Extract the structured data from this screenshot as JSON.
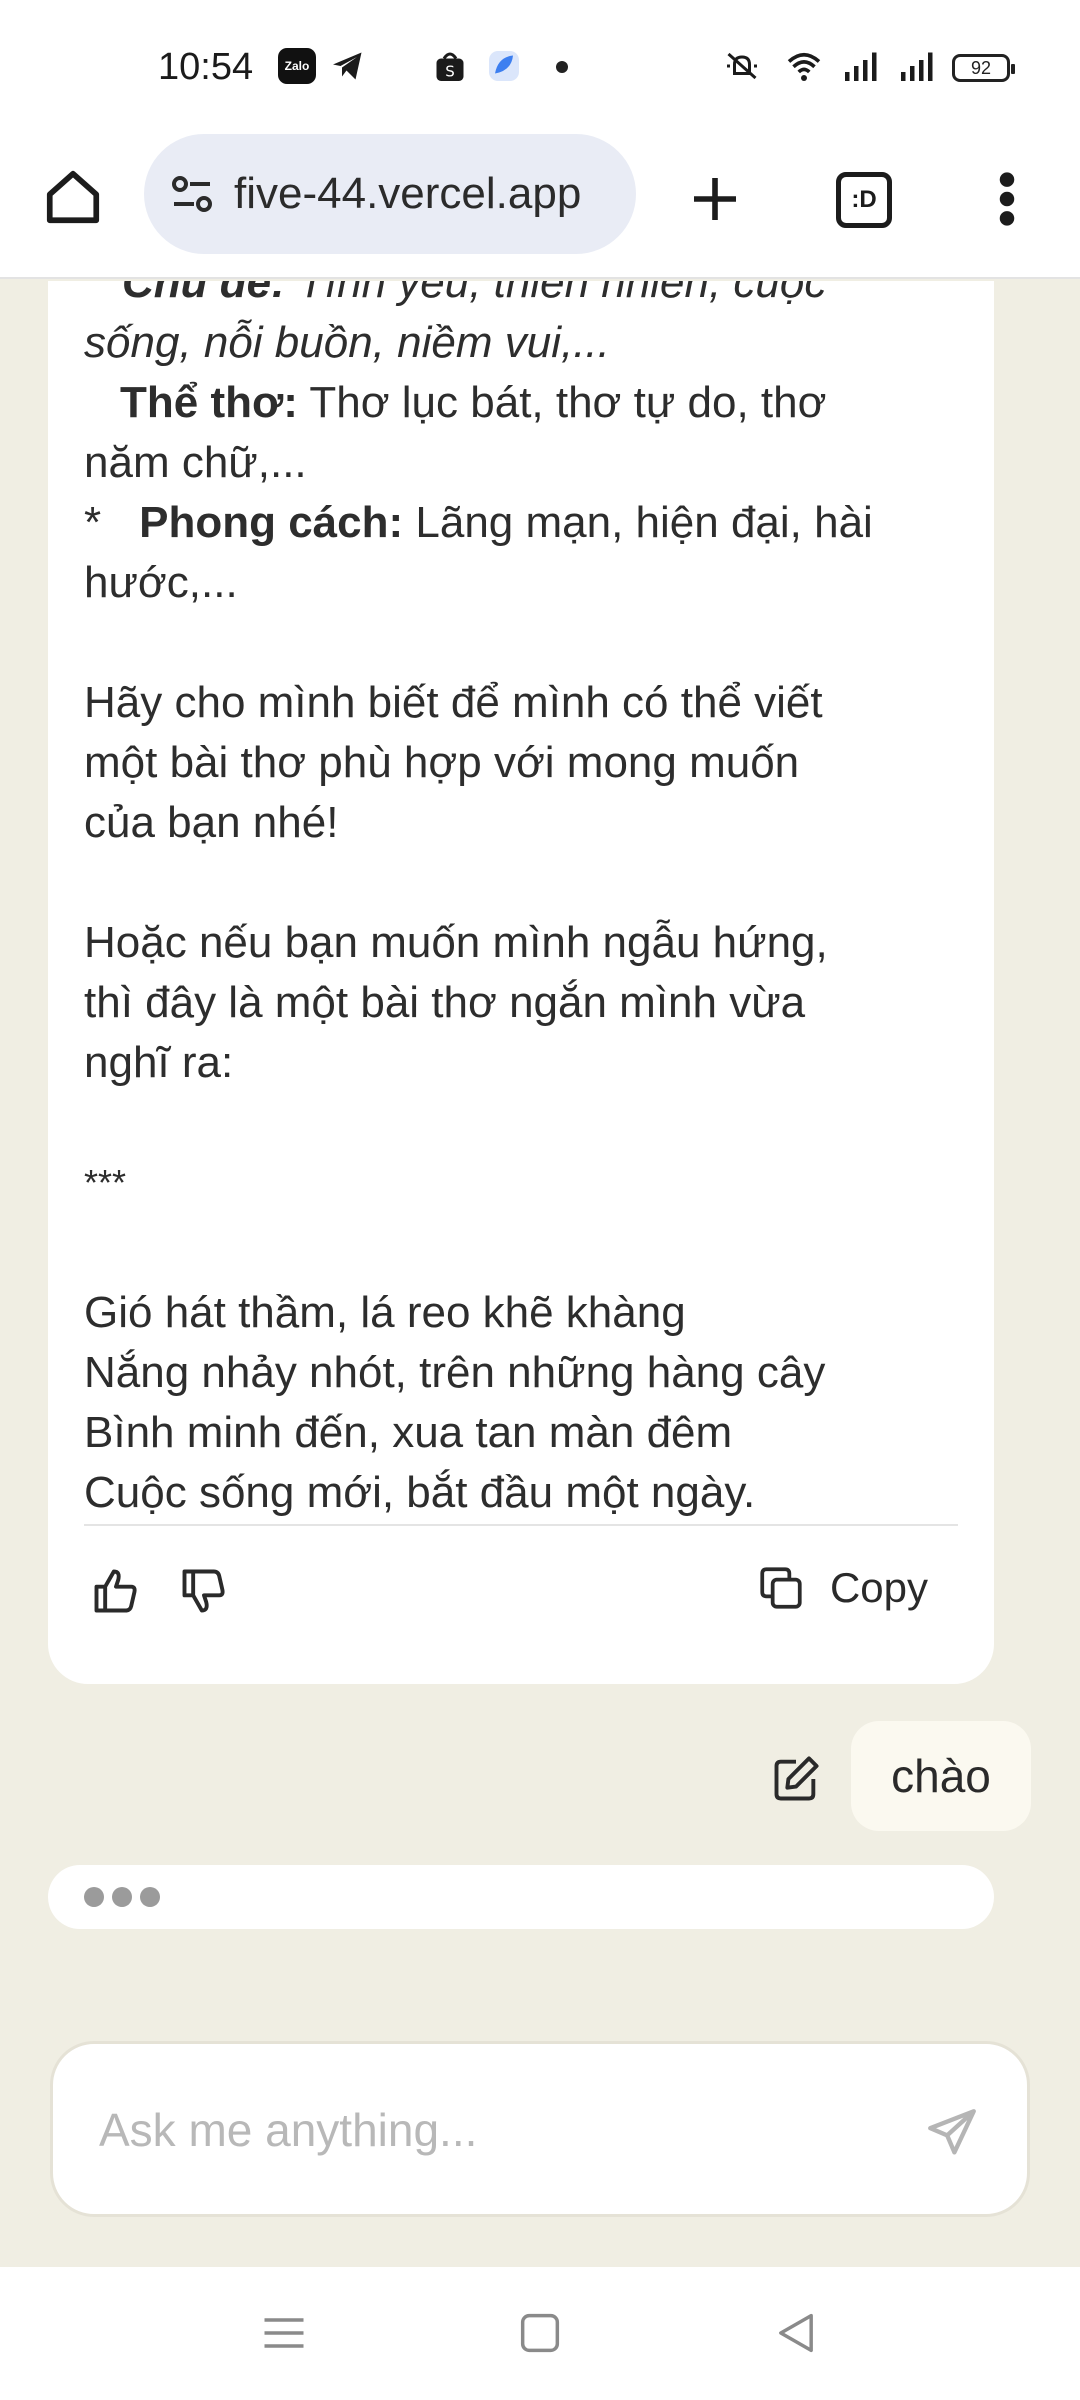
{
  "status_bar": {
    "time": "10:54",
    "battery": "92",
    "zalo_label": "Zalo",
    "icons": [
      "zalo-icon",
      "telegram-icon",
      "shopee-icon",
      "app-icon",
      "notification-dot",
      "mute-icon",
      "wifi-icon",
      "signal-icon",
      "signal-icon",
      "battery-icon"
    ]
  },
  "browser": {
    "url": "five-44.vercel.app",
    "tab_count": ":D",
    "icons": [
      "home-icon",
      "site-settings-icon",
      "new-tab-icon",
      "tabs-icon",
      "more-icon"
    ]
  },
  "assistant": {
    "lines": [
      {
        "label": "Chủ đề:",
        "text": " Tình yêu, thiên nhiên, cuộc"
      },
      {
        "text": "sống, nỗi buồn, niềm vui,..."
      },
      {
        "label": "Thể thơ:",
        "text": " Thơ lục bát, thơ tự do, thơ"
      },
      {
        "text": "năm chữ,..."
      },
      {
        "bullet": "*",
        "label": "Phong cách:",
        "text": " Lãng mạn, hiện đại, hài"
      },
      {
        "text": "hước,..."
      }
    ],
    "para1": [
      "Hãy cho mình biết để mình có thể viết",
      "một bài thơ phù hợp với mong muốn",
      "của bạn nhé!"
    ],
    "para2": [
      "Hoặc nếu bạn muốn mình ngẫu hứng,",
      "thì đây là một bài thơ ngắn mình vừa",
      "nghĩ ra:"
    ],
    "separator": "***",
    "poem": [
      "Gió hát thầm, lá reo khẽ khàng",
      "Nắng nhảy nhót, trên những hàng cây",
      "Bình minh đến, xua tan màn đêm",
      "Cuộc sống mới, bắt đầu một ngày."
    ],
    "copy_label": "Copy"
  },
  "user_message": "chào",
  "input": {
    "placeholder": "Ask me anything..."
  },
  "colors": {
    "background": "#f0eee3",
    "card": "#ffffff",
    "user_bubble": "#fbf9f0",
    "url_bar": "#e9ecf5"
  }
}
